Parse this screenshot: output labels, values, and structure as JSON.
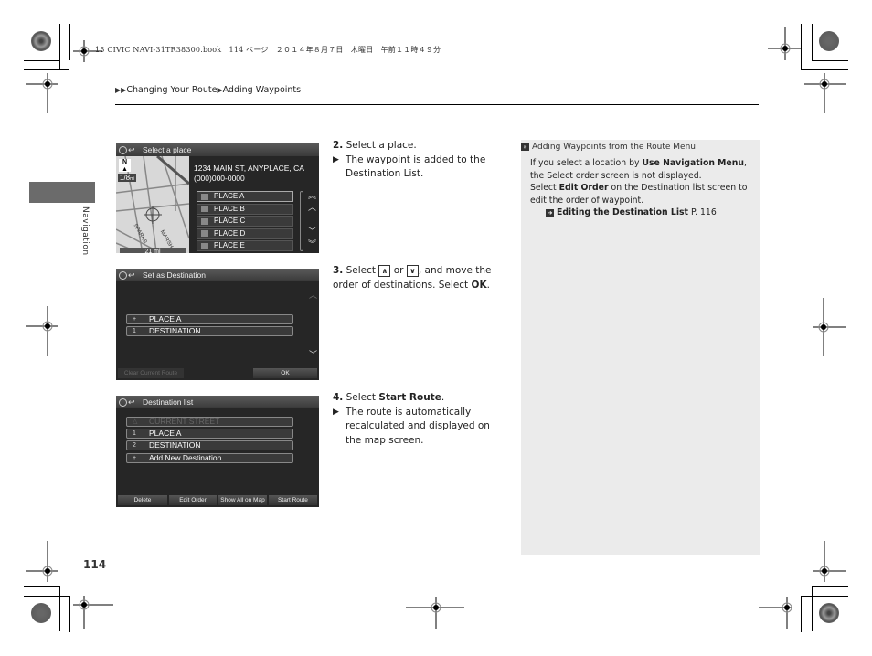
{
  "print_header": "15 CIVIC NAVI-31TR38300.book　114 ページ　２０１４年８月７日　木曜日　午前１１時４９分",
  "breadcrumb": {
    "prefix_icon": "double-triangle-icon",
    "items": [
      "Changing Your Route",
      "Adding Waypoints"
    ]
  },
  "section_tab": "Navigation",
  "page_number": "114",
  "screens": {
    "select_place": {
      "title": "Select a place",
      "address_line1": "1234 MAIN ST, ANYPLACE, CA",
      "address_line2": "(000)000-0000",
      "map_scale": "1/8",
      "map_scale_unit": "mi",
      "north_label": "N",
      "street_labels": [
        "SPARKS",
        "MARSH"
      ],
      "distance_label": "21 mi",
      "places": [
        {
          "label": "PLACE A",
          "icon": "hotel-icon",
          "selected": true
        },
        {
          "label": "PLACE B",
          "icon": "hotel-icon",
          "selected": false
        },
        {
          "label": "PLACE C",
          "icon": "car-icon",
          "selected": false
        },
        {
          "label": "PLACE D",
          "icon": "hotel-icon",
          "selected": false
        },
        {
          "label": "PLACE E",
          "icon": "car-icon",
          "selected": false
        }
      ]
    },
    "set_destination": {
      "title": "Set as Destination",
      "items": [
        {
          "lead": "+",
          "label": "PLACE A"
        },
        {
          "lead": "1",
          "label": "DESTINATION"
        }
      ],
      "clear_button": "Clear Current Route",
      "ok_button": "OK"
    },
    "destination_list": {
      "title": "Destination list",
      "items": [
        {
          "lead": "△",
          "label": "CURRENT STREET",
          "disabled": true
        },
        {
          "lead": "1",
          "label": "PLACE A",
          "disabled": false
        },
        {
          "lead": "2",
          "label": "DESTINATION",
          "disabled": false
        },
        {
          "lead": "+",
          "label": "Add New Destination",
          "disabled": false
        }
      ],
      "buttons": [
        "Delete",
        "Edit Order",
        "Show All on Map",
        "Start Route"
      ]
    }
  },
  "steps": [
    {
      "num": "2.",
      "text": "Select a place.",
      "result": "The waypoint is added to the Destination List."
    },
    {
      "num": "3.",
      "text_a": "Select",
      "up_key": "∧",
      "text_or": "or",
      "down_key": "∨",
      "text_b": ", and move the order of destinations. Select",
      "bold_end": "OK",
      "text_end": "."
    },
    {
      "num": "4.",
      "text": "Select",
      "bold": "Start Route",
      "text_end": ".",
      "result": "The route is automatically recalculated and displayed on the map screen."
    }
  ],
  "sidebar_note": {
    "title": "Adding Waypoints from the Route Menu",
    "p1_a": "If you select a location by",
    "p1_bold": "Use Navigation Menu",
    "p1_b": ", the Select order screen is not displayed.",
    "p2_a": "Select",
    "p2_bold": "Edit Order",
    "p2_b": "on the Destination list screen to edit the order of waypoint.",
    "ref_bold": "Editing the Destination List",
    "ref_page": "P. 116"
  }
}
